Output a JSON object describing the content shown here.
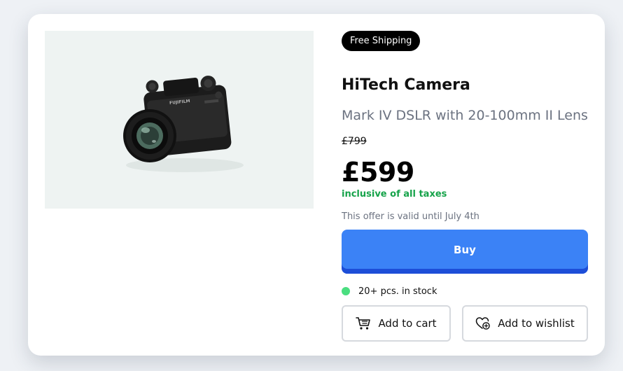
{
  "product": {
    "badge": "Free Shipping",
    "title": "HiTech Camera",
    "subtitle": "Mark IV DSLR with 20-100mm II Lens",
    "old_price": "£799",
    "price": "£599",
    "tax_note": "inclusive of all taxes",
    "offer": "This offer is valid until July 4th",
    "image_alt": "Black mirrorless camera with lens",
    "camera_brand_mark": "FUJIFILM"
  },
  "actions": {
    "buy_label": "Buy",
    "cart_label": "Add to cart",
    "wishlist_label": "Add to wishlist",
    "cart_icon": "cart-icon",
    "wishlist_icon": "heart-plus-icon"
  },
  "stock": {
    "text": "20+ pcs. in stock",
    "status_color": "#4ade80"
  },
  "colors": {
    "buy_button": "#3b82f6",
    "buy_button_edge": "#1d4ed8",
    "tax_note": "#16a34a",
    "badge_bg": "#000000"
  }
}
